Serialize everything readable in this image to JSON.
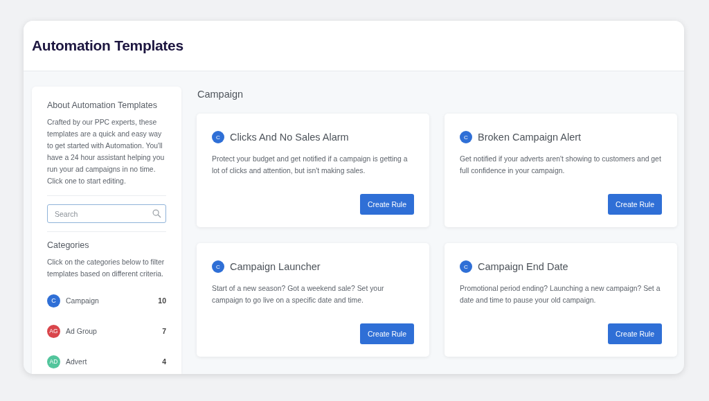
{
  "window": {
    "title": "Automation Templates"
  },
  "sidebar": {
    "about_title": "About Automation Templates",
    "about_text": "Crafted by our PPC experts, these templates are a quick and easy way to get started with Automation. You'll have a 24 hour assistant helping you run your ad campaigns in no time. Click one to start editing.",
    "search": {
      "placeholder": "Search",
      "focused": true
    },
    "categories_title": "Categories",
    "categories_text": "Click on the categories below to filter templates based on different criteria.",
    "categories": [
      {
        "badge": "C",
        "label": "Campaign",
        "count": "10",
        "color": "#2f6fd6"
      },
      {
        "badge": "AG",
        "label": "Ad Group",
        "count": "7",
        "color": "#d9454b"
      },
      {
        "badge": "AD",
        "label": "Advert",
        "count": "4",
        "color": "#52c59c"
      }
    ]
  },
  "section": {
    "title": "Campaign",
    "cards": [
      {
        "badge": "C",
        "title": "Clicks And No Sales Alarm",
        "text": "Protect your budget and get notified if a campaign is getting a lot of clicks and attention, but isn't making sales.",
        "button": "Create Rule"
      },
      {
        "badge": "C",
        "title": "Broken Campaign Alert",
        "text": "Get notified if your adverts aren't showing to customers and get full confidence in your campaign.",
        "button": "Create Rule"
      },
      {
        "badge": "C",
        "title": "Campaign Launcher",
        "text": "Start of a new season? Got a weekend sale? Set your campaign to go live on a specific date and time.",
        "button": "Create Rule"
      },
      {
        "badge": "C",
        "title": "Campaign End Date",
        "text": "Promotional period ending? Launching a new campaign? Set a date and time to pause your old campaign.",
        "button": "Create Rule"
      }
    ]
  }
}
